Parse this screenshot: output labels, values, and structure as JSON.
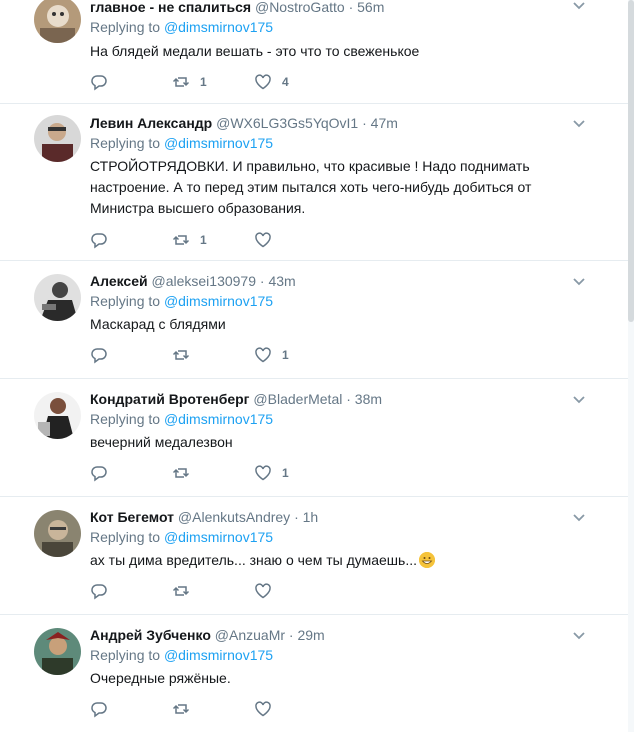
{
  "tweets": [
    {
      "name": "главное - не спалиться",
      "handle": "@NostroGatto",
      "time": "56m",
      "replying_prefix": "Replying to ",
      "replying_to": "@dimsmirnov175",
      "text": "На блядей медали вешать - это что то свеженькое",
      "retweets": "1",
      "likes": "4",
      "avatar_color": "#b49a7a"
    },
    {
      "name": "Левин Александр",
      "handle": "@WX6LG3Gs5YqOvI1",
      "time": "47m",
      "replying_prefix": "Replying to ",
      "replying_to": "@dimsmirnov175",
      "text": "СТРОЙОТРЯДОВКИ. И правильно, что красивые ! Надо поднимать настроение. А то перед этим пытался хоть чего-нибудь добиться от Министра высшего образования.",
      "retweets": "1",
      "likes": "",
      "avatar_color": "#c8c8c8"
    },
    {
      "name": "Алексей",
      "handle": "@aleksei130979",
      "time": "43m",
      "replying_prefix": "Replying to ",
      "replying_to": "@dimsmirnov175",
      "text": "Маскарад с блядями",
      "retweets": "",
      "likes": "1",
      "avatar_color": "#555555"
    },
    {
      "name": "Кондратий Вротенберг",
      "handle": "@BladerMetal",
      "time": "38m",
      "replying_prefix": "Replying to ",
      "replying_to": "@dimsmirnov175",
      "text": "вечерний медалезвон",
      "retweets": "",
      "likes": "1",
      "avatar_color": "#8a7f7a"
    },
    {
      "name": "Кот Бегемот",
      "handle": "@AlenkutsAndrey",
      "time": "1h",
      "replying_prefix": "Replying to ",
      "replying_to": "@dimsmirnov175",
      "text": "ах ты дима вредитель... знаю о чем ты думаешь...",
      "retweets": "",
      "likes": "",
      "avatar_color": "#6e6a5a"
    },
    {
      "name": "Андрей Зубченко",
      "handle": "@AnzuaMr",
      "time": "29m",
      "replying_prefix": "Replying to ",
      "replying_to": "@dimsmirnov175",
      "text": "Очередные ряжёные.",
      "retweets": "",
      "likes": "",
      "avatar_color": "#4a7a6a"
    }
  ],
  "colors": {
    "accent": "#1da1f2",
    "muted": "#657786",
    "divider": "#e6ecf0"
  },
  "icons": [
    "reply-icon",
    "retweet-icon",
    "like-icon",
    "caret-down-icon",
    "grinning-emoji-icon"
  ]
}
